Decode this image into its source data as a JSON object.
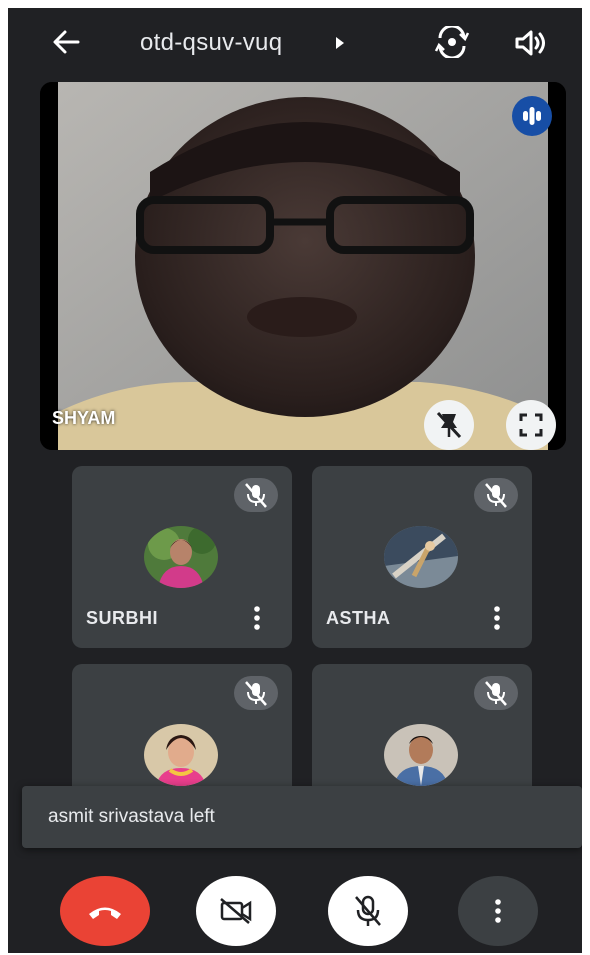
{
  "header": {
    "meeting_code": "otd-qsuv-vuq",
    "icons": [
      "back-arrow-icon",
      "caret-right-icon",
      "switch-camera-icon",
      "speaker-icon"
    ]
  },
  "main_video": {
    "name": "SHYAM",
    "icons": [
      "speaking-indicator-icon",
      "unpin-icon",
      "fullscreen-icon"
    ]
  },
  "participants": [
    {
      "name": "SURBHI",
      "muted": true
    },
    {
      "name": "ASTHA",
      "muted": true
    },
    {
      "name": "",
      "muted": true
    },
    {
      "name": "",
      "muted": true
    }
  ],
  "toast": {
    "message": "asmit srivastava left"
  },
  "controls": {
    "icons": [
      "end-call-icon",
      "camera-off-icon",
      "mic-off-icon",
      "more-options-icon"
    ]
  },
  "colors": {
    "background": "#202124",
    "tile": "#3c4043",
    "end_call": "#ea4335",
    "speaking_badge": "#174ea6"
  }
}
